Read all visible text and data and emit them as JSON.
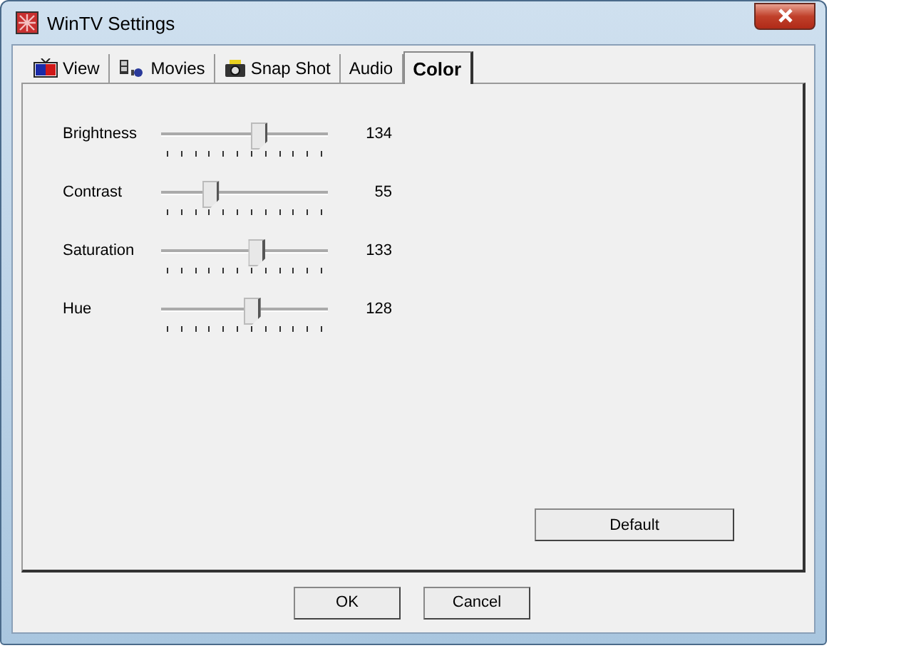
{
  "window": {
    "title": "WinTV Settings"
  },
  "tabs": [
    {
      "label": "View",
      "selected": false
    },
    {
      "label": "Movies",
      "selected": false
    },
    {
      "label": "Snap Shot",
      "selected": false
    },
    {
      "label": "Audio",
      "selected": false
    },
    {
      "label": "Color",
      "selected": true
    }
  ],
  "sliders": [
    {
      "label": "Brightness",
      "level": 0.56,
      "reading": "134"
    },
    {
      "label": "Contrast",
      "level": 0.27,
      "reading": "55"
    },
    {
      "label": "Saturation",
      "level": 0.55,
      "reading": "133"
    },
    {
      "label": "Hue",
      "level": 0.52,
      "reading": "128"
    }
  ],
  "default_button": "Default",
  "buttons": [
    "OK",
    "Cancel"
  ]
}
